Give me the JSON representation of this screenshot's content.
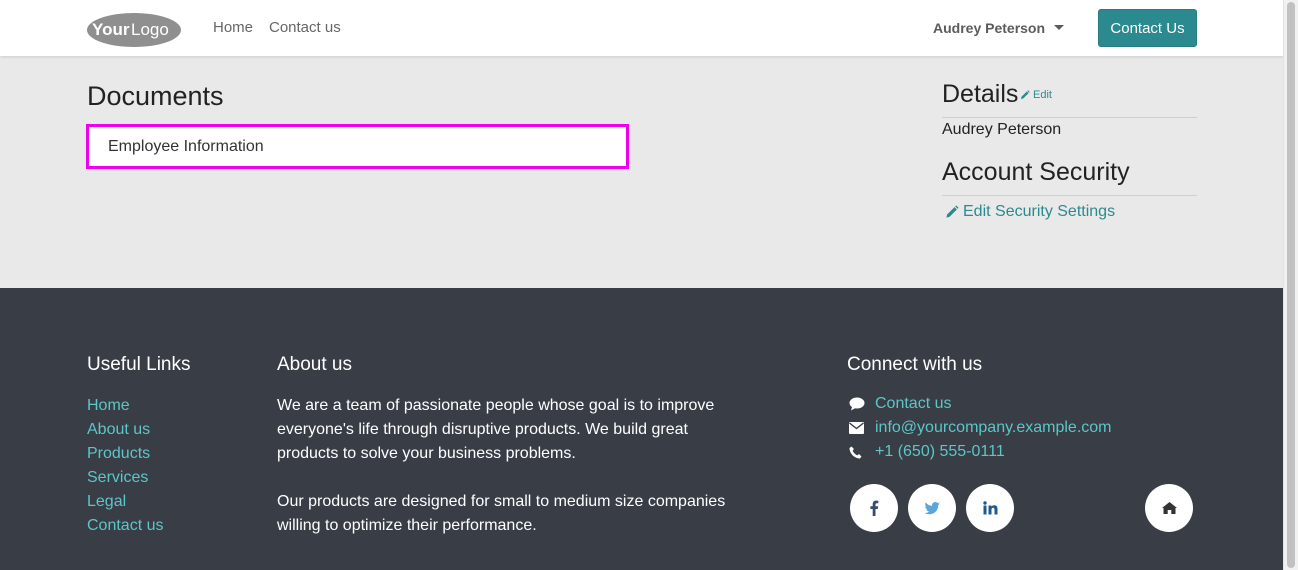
{
  "header": {
    "logo_text": "YourLogo",
    "nav": [
      "Home",
      "Contact us"
    ],
    "user_name": "Audrey Peterson",
    "contact_button": "Contact Us"
  },
  "main": {
    "documents_title": "Documents",
    "document_item": "Employee Information",
    "details_title": "Details",
    "edit_label": "Edit",
    "details_name": "Audrey Peterson",
    "security_title": "Account Security",
    "security_link": "Edit Security Settings"
  },
  "footer": {
    "useful_links_title": "Useful Links",
    "useful_links": [
      "Home",
      "About us",
      "Products",
      "Services",
      "Legal",
      "Contact us"
    ],
    "about_title": "About us",
    "about_p1": "We are a team of passionate people whose goal is to improve everyone's life through disruptive products. We build great products to solve your business problems.",
    "about_p2": "Our products are designed for small to medium size companies willing to optimize their performance.",
    "connect_title": "Connect with us",
    "connect_items": [
      {
        "icon": "comment-icon",
        "label": "Contact us"
      },
      {
        "icon": "envelope-icon",
        "label": "info@yourcompany.example.com"
      },
      {
        "icon": "phone-icon",
        "label": "+1 (650) 555-0111"
      }
    ],
    "social": [
      "facebook-icon",
      "twitter-icon",
      "linkedin-icon",
      "home-icon"
    ]
  },
  "colors": {
    "accent": "#2b8a90",
    "link_footer": "#5cc6c8",
    "footer_bg": "#383d46",
    "highlight_border": "#ee00ee",
    "body_bg": "#e9e9e9"
  }
}
